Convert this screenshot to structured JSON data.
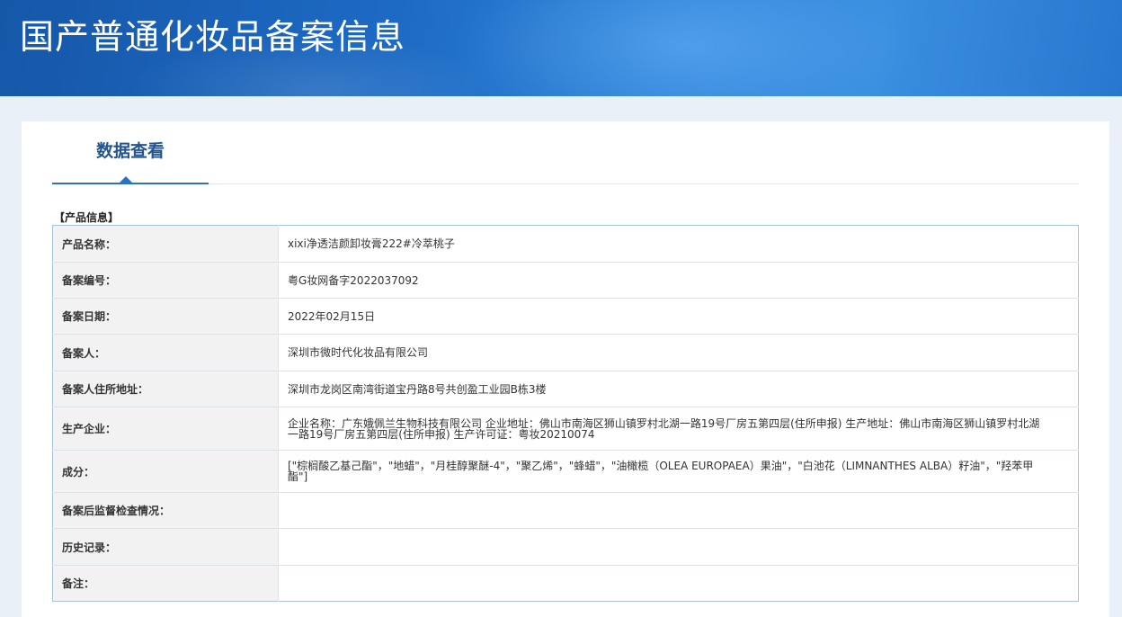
{
  "header": {
    "title": "国产普通化妆品备案信息"
  },
  "tabs": [
    {
      "label": "数据查看"
    }
  ],
  "section": {
    "title": "【产品信息】"
  },
  "rows": [
    {
      "label": "产品名称：",
      "value": "xixi净透洁颜卸妆膏222#冷萃桃子"
    },
    {
      "label": "备案编号：",
      "value": "粤G妆网备字2022037092"
    },
    {
      "label": "备案日期：",
      "value": "2022年02月15日"
    },
    {
      "label": "备案人：",
      "value": "深圳市微时代化妆品有限公司"
    },
    {
      "label": "备案人住所地址：",
      "value": "深圳市龙岗区南湾街道宝丹路8号共创盈工业园B栋3楼"
    },
    {
      "label": "生产企业：",
      "value": "企业名称：广东娥佩兰生物科技有限公司 企业地址：佛山市南海区狮山镇罗村北湖一路19号厂房五第四层(住所申报) 生产地址：佛山市南海区狮山镇罗村北湖一路19号厂房五第四层(住所申报) 生产许可证：粤妆20210074"
    },
    {
      "label": "成分：",
      "value": "[\"棕榈酸乙基己酯\"，\"地蜡\"，\"月桂醇聚醚-4\"，\"聚乙烯\"，\"蜂蜡\"，\"油橄榄（OLEA EUROPAEA）果油\"，\"白池花（LIMNANTHES ALBA）籽油\"，\"羟苯甲酯\"]"
    },
    {
      "label": "备案后监督检查情况：",
      "value": ""
    },
    {
      "label": "历史记录：",
      "value": ""
    },
    {
      "label": "备注：",
      "value": ""
    }
  ]
}
